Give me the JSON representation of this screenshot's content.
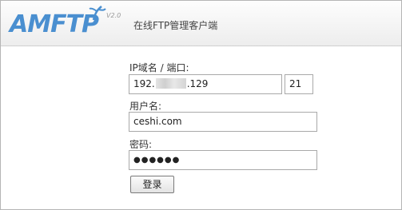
{
  "header": {
    "logo_text": "AMFTP",
    "version": "V2.0",
    "subtitle": "在线FTP管理客户端"
  },
  "login": {
    "host_label": "IP域名 / 端口:",
    "host_prefix": "192.",
    "host_suffix": ".129",
    "port_value": "21",
    "username_label": "用户名:",
    "username_value": "ceshi.com",
    "password_label": "密码:",
    "password_value": "●●●●●●",
    "submit_label": "登录"
  },
  "colors": {
    "brand": "#4a8fd0",
    "header_bg": "#f2f2f2",
    "border": "#a9a9a9"
  }
}
